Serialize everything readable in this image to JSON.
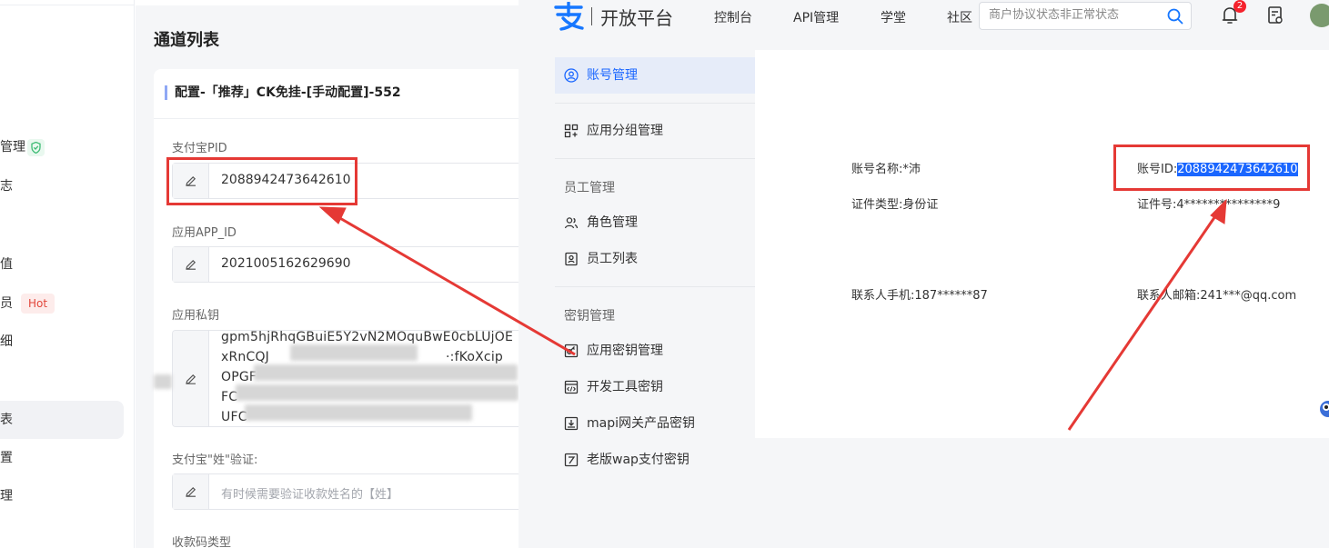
{
  "left_app": {
    "sidebar": {
      "items": [
        {
          "label": "管理",
          "badge": "shield"
        },
        {
          "label": "志",
          "badge": ""
        },
        {
          "label": "值",
          "badge": ""
        },
        {
          "label": "员",
          "badge": "Hot"
        },
        {
          "label": "细",
          "badge": ""
        },
        {
          "label": "表",
          "badge": "",
          "active": true
        },
        {
          "label": "置",
          "badge": ""
        },
        {
          "label": "理",
          "badge": ""
        }
      ]
    },
    "page_title": "通道列表",
    "card": {
      "title": "配置-「推荐」CK免挂-[手动配置]-552",
      "fields": [
        {
          "label": "支付宝PID",
          "value": "2088942473642610"
        },
        {
          "label": "应用APP_ID",
          "value": "2021005162629690"
        },
        {
          "label": "应用私钥",
          "lines": [
            "gpm5hjRhqGBuiE5Y2vN2MOquBwE0cbLUjOE",
            "xRnCQJ",
            "OPGF",
            "FC",
            "UFC"
          ],
          "line_tails": [
            "",
            "·:fKoXcip",
            "",
            "",
            ""
          ]
        },
        {
          "label": "支付宝\"姓\"验证:",
          "placeholder": "有时候需要验证收款姓名的【姓】"
        },
        {
          "label": "收款码类型"
        }
      ]
    }
  },
  "alipay": {
    "logo_text": "开放平台",
    "nav": [
      "控制台",
      "API管理",
      "学堂",
      "社区"
    ],
    "search_placeholder": "商户协议状态非正常状态",
    "notification_count": "2",
    "sidebar": {
      "account_item": "账号管理",
      "group_item": "应用分组管理",
      "staff_header": "员工管理",
      "role_item": "角色管理",
      "staff_list_item": "员工列表",
      "key_header": "密钥管理",
      "app_key_item": "应用密钥管理",
      "dev_key_item": "开发工具密钥",
      "mapi_item": "mapi网关产品密钥",
      "wap_item": "老版wap支付密钥"
    },
    "account_info": {
      "name_label": "账号名称:",
      "name_value": "*沛",
      "id_label": "账号ID:",
      "id_value": "2088942473642610",
      "cert_type_label": "证件类型:",
      "cert_type_value": "身份证",
      "cert_no_label": "证件号:",
      "cert_no_value": "4***************9",
      "phone_label": "联系人手机:",
      "phone_value": "187******87",
      "email_label": "联系人邮箱:",
      "email_value": "241***@qq.com"
    }
  },
  "colors": {
    "annotation_red": "#e53935",
    "alipay_blue": "#1a66ff",
    "hot_red": "#e2463a"
  }
}
